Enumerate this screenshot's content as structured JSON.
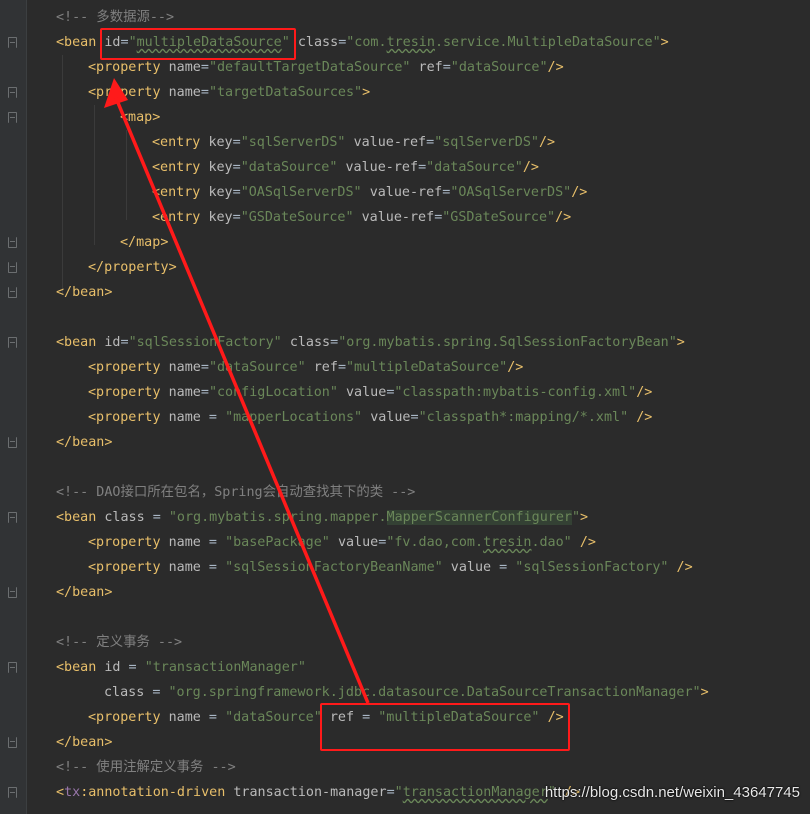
{
  "lines": [
    {
      "text": "<!-- 多数据源-->"
    },
    {
      "text": "<bean id=\"multipleDataSource\" class=\"com.tresin.service.MultipleDataSource\">"
    },
    {
      "text": "<property name=\"defaultTargetDataSource\" ref=\"dataSource\"/>"
    },
    {
      "text": "<property name=\"targetDataSources\">"
    },
    {
      "text": "<map>"
    },
    {
      "text": "<entry key=\"sqlServerDS\" value-ref=\"sqlServerDS\"/>"
    },
    {
      "text": "<entry key=\"dataSource\" value-ref=\"dataSource\"/>"
    },
    {
      "text": "<entry key=\"OASqlServerDS\" value-ref=\"OASqlServerDS\"/>"
    },
    {
      "text": "<entry key=\"GSDateSource\" value-ref=\"GSDateSource\"/>"
    },
    {
      "text": "</map>"
    },
    {
      "text": "</property>"
    },
    {
      "text": "</bean>"
    },
    {
      "text": ""
    },
    {
      "text": "<bean id=\"sqlSessionFactory\" class=\"org.mybatis.spring.SqlSessionFactoryBean\">"
    },
    {
      "text": "<property name=\"dataSource\" ref=\"multipleDataSource\"/>"
    },
    {
      "text": "<property name=\"configLocation\" value=\"classpath:mybatis-config.xml\"/>"
    },
    {
      "text": "<property name = \"mapperLocations\" value=\"classpath*:mapping/*.xml\" />"
    },
    {
      "text": "</bean>"
    },
    {
      "text": ""
    },
    {
      "text": "<!-- DAO接口所在包名，Spring会自动查找其下的类 -->"
    },
    {
      "text": "<bean class = \"org.mybatis.spring.mapper.MapperScannerConfigurer\">"
    },
    {
      "text": "<property name = \"basePackage\" value=\"fv.dao,com.tresin.dao\" />"
    },
    {
      "text": "<property name = \"sqlSessionFactoryBeanName\" value = \"sqlSessionFactory\" />"
    },
    {
      "text": "</bean>"
    },
    {
      "text": ""
    },
    {
      "text": "<!-- 定义事务 -->"
    },
    {
      "text": "<bean id = \"transactionManager\""
    },
    {
      "text": "class = \"org.springframework.jdbc.datasource.DataSourceTransactionManager\">"
    },
    {
      "text": "<property name = \"dataSource\" ref = \"multipleDataSource\" />"
    },
    {
      "text": "</bean>"
    },
    {
      "text": "<!-- 使用注解定义事务 -->"
    },
    {
      "text": "<tx:annotation-driven transaction-manager=\"transactionManager\" />"
    }
  ],
  "watermark": "https://blog.csdn.net/weixin_43647745",
  "colors": {
    "background": "#2b2b2b",
    "gutter": "#313335",
    "tag": "#e8bf6a",
    "attribute": "#bababa",
    "value": "#6a8759",
    "comment": "#808080",
    "namespace": "#9876aa",
    "annotation": "#ff1a1a"
  }
}
